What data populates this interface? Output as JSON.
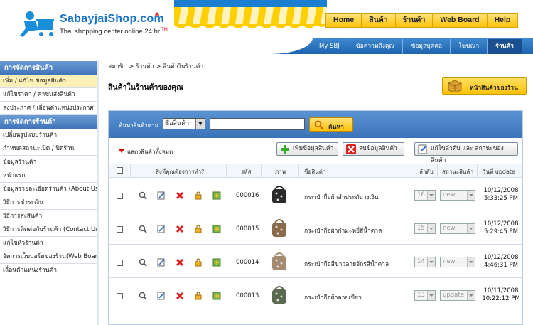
{
  "brand": {
    "name": "SabayjaiShop.com",
    "registered": "®",
    "tagline": "Thai shopping center online 24 hr.",
    "tm": "TM"
  },
  "top_nav": [
    "Home",
    "สินค้า",
    "ร้านค้า",
    "Web Board",
    "Help"
  ],
  "sub_tabs": [
    {
      "label": "My SBJ",
      "active": false
    },
    {
      "label": "ข้อความถึงคุณ",
      "active": false
    },
    {
      "label": "ข้อมูลบุคคล",
      "active": false
    },
    {
      "label": "โฆษณา",
      "active": false
    },
    {
      "label": "ร้านค้า",
      "active": true
    }
  ],
  "sidebar": {
    "product_section": "การจัดการสินค้า",
    "product_items": [
      {
        "label": "เพิ่ม / แก้ไข ข้อมูลสินค้า",
        "active": true
      },
      {
        "label": "แก้ไขราคา / ค่าขนส่งสินค้า",
        "active": false
      },
      {
        "label": "ลงประกาศ / เลื่อนตำแหน่งประกาศ",
        "active": false
      }
    ],
    "shop_section": "การจัดการร้านค้า",
    "shop_items": [
      "เปลี่ยนรูปแบบร้านค้า",
      "กำหนดสถานะเปิด / ปิดร้าน",
      "ข้อมูลร้านค้า",
      "หน้าแรก",
      "ข้อมูลรายละเอียดร้านค้า (About Us)",
      "วิธีการชำระเงิน",
      "วิธีการส่งสินค้า",
      "วิธีการติดต่อกับร้านค้า (Contact Us)",
      "แก้ไขหัวร้านค้า",
      "จัดการเว็บบอร์ดของร้าน(Web Board)",
      "เลื่อนตำแหน่งร้านค้า"
    ]
  },
  "breadcrumb": "สมาชิก > ร้านค้า > สินค้าในร้านค้า",
  "page_title": "สินค้าในร้านค้าของคุณ",
  "store_button": "หน้าสินค้าของร้าน",
  "search": {
    "label": "ค้นหาสินค้าตาม :",
    "field": "ชื่อสินค้า",
    "button": "ค้นหา",
    "value": ""
  },
  "actions": {
    "show_all": "แสดงสินค้าทั้งหมด",
    "add": "เพิ่มข้อมูลสินค้า",
    "delete": "ลบข้อมูลสินค้า",
    "reorder": "แก้ไขลำดับ และ สถานะของสินค้า"
  },
  "columns": [
    "สิ่งที่คุณต้องการทำ?",
    "รหัส",
    "ภาพ",
    "ชื่อสินค้า",
    "ลำดับ",
    "สถานะสินค้า",
    "วันที่ update"
  ],
  "products": [
    {
      "code": "000016",
      "name": "กระเป๋าถือผ้าลำประดับวงเงิน",
      "order": "16",
      "status": "new",
      "date": "10/12/2008",
      "time": "5:33:25 PM",
      "thumb_color": "#2a2a2a"
    },
    {
      "code": "000015",
      "name": "กระเป๋าถือผ้ากำมะหยี่สีน้ำตาล",
      "order": "15",
      "status": "new",
      "date": "10/12/2008",
      "time": "5:29:45 PM",
      "thumb_color": "#8a6a4a"
    },
    {
      "code": "000014",
      "name": "กระเป๋าถือสีขาวลายจักรสีน้ำตาล",
      "order": "14",
      "status": "new",
      "date": "10/12/2008",
      "time": "4:46:31 PM",
      "thumb_color": "#a58a70"
    },
    {
      "code": "000013",
      "name": "กระเป๋าถือผ้าลายเขียว",
      "order": "13",
      "status": "update",
      "date": "10/11/2008",
      "time": "10:22:12 PM",
      "thumb_color": "#5a6a50"
    }
  ]
}
